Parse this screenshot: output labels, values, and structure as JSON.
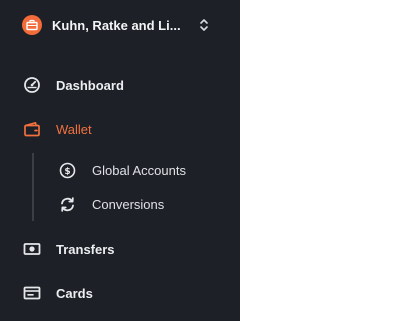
{
  "org": {
    "name": "Kuhn, Ratke and Li..."
  },
  "nav": {
    "dashboard": "Dashboard",
    "wallet": "Wallet",
    "global_accounts": "Global Accounts",
    "conversions": "Conversions",
    "transfers": "Transfers",
    "cards": "Cards"
  },
  "colors": {
    "sidebar_bg": "#1d2026",
    "accent": "#f2713f",
    "page_bg": "#ffffff"
  },
  "icons": {
    "org": "briefcase-icon",
    "dashboard": "gauge-icon",
    "wallet": "wallet-icon",
    "global_accounts": "dollar-circle-icon",
    "conversions": "refresh-icon",
    "transfers": "banknote-icon",
    "cards": "card-icon"
  }
}
